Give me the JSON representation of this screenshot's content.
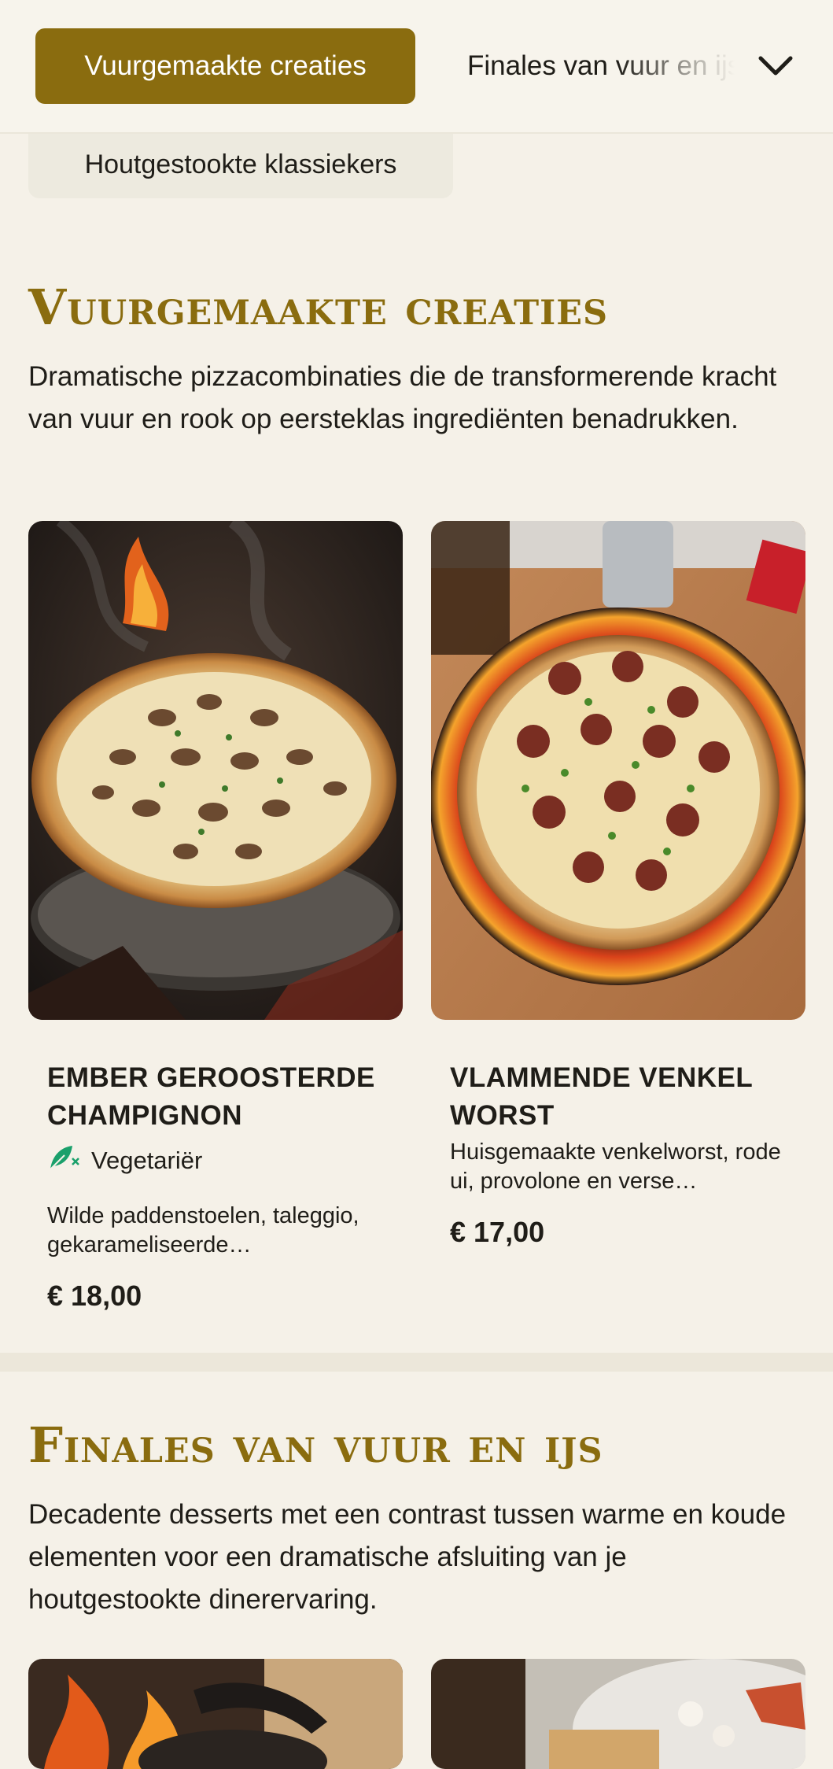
{
  "nav": {
    "active_category": "Vuurgemaakte creaties",
    "next_category": "Finales van vuur en ijs",
    "sub_category": "Houtgestookte klassiekers",
    "expand_icon": "chevron-down-icon"
  },
  "sections": [
    {
      "title": "Vuurgemaakte creaties",
      "description": "Dramatische pizzacombinaties die de transformerende kracht van vuur en rook op eersteklas ingrediënten benadrukken.",
      "items": [
        {
          "name": "Ember geroosterde champignon",
          "badge": "Vegetariër",
          "description": "Wilde paddenstoelen, taleggio, gekarameliseerde…",
          "price": "€ 18,00"
        },
        {
          "name": "Vlammende venkel worst",
          "description": "Huisgemaakte venkelworst, rode ui, provolone en verse…",
          "price": "€ 17,00"
        }
      ]
    },
    {
      "title": "Finales van vuur en ijs",
      "description": "Decadente desserts met een contrast tussen warme en koude elementen voor een dramatische afsluiting van je houtgestookte dinerervaring."
    }
  ],
  "colors": {
    "accent": "#8a6c0f",
    "background": "#f5f1e8",
    "veg_icon": "#1aa06b"
  }
}
